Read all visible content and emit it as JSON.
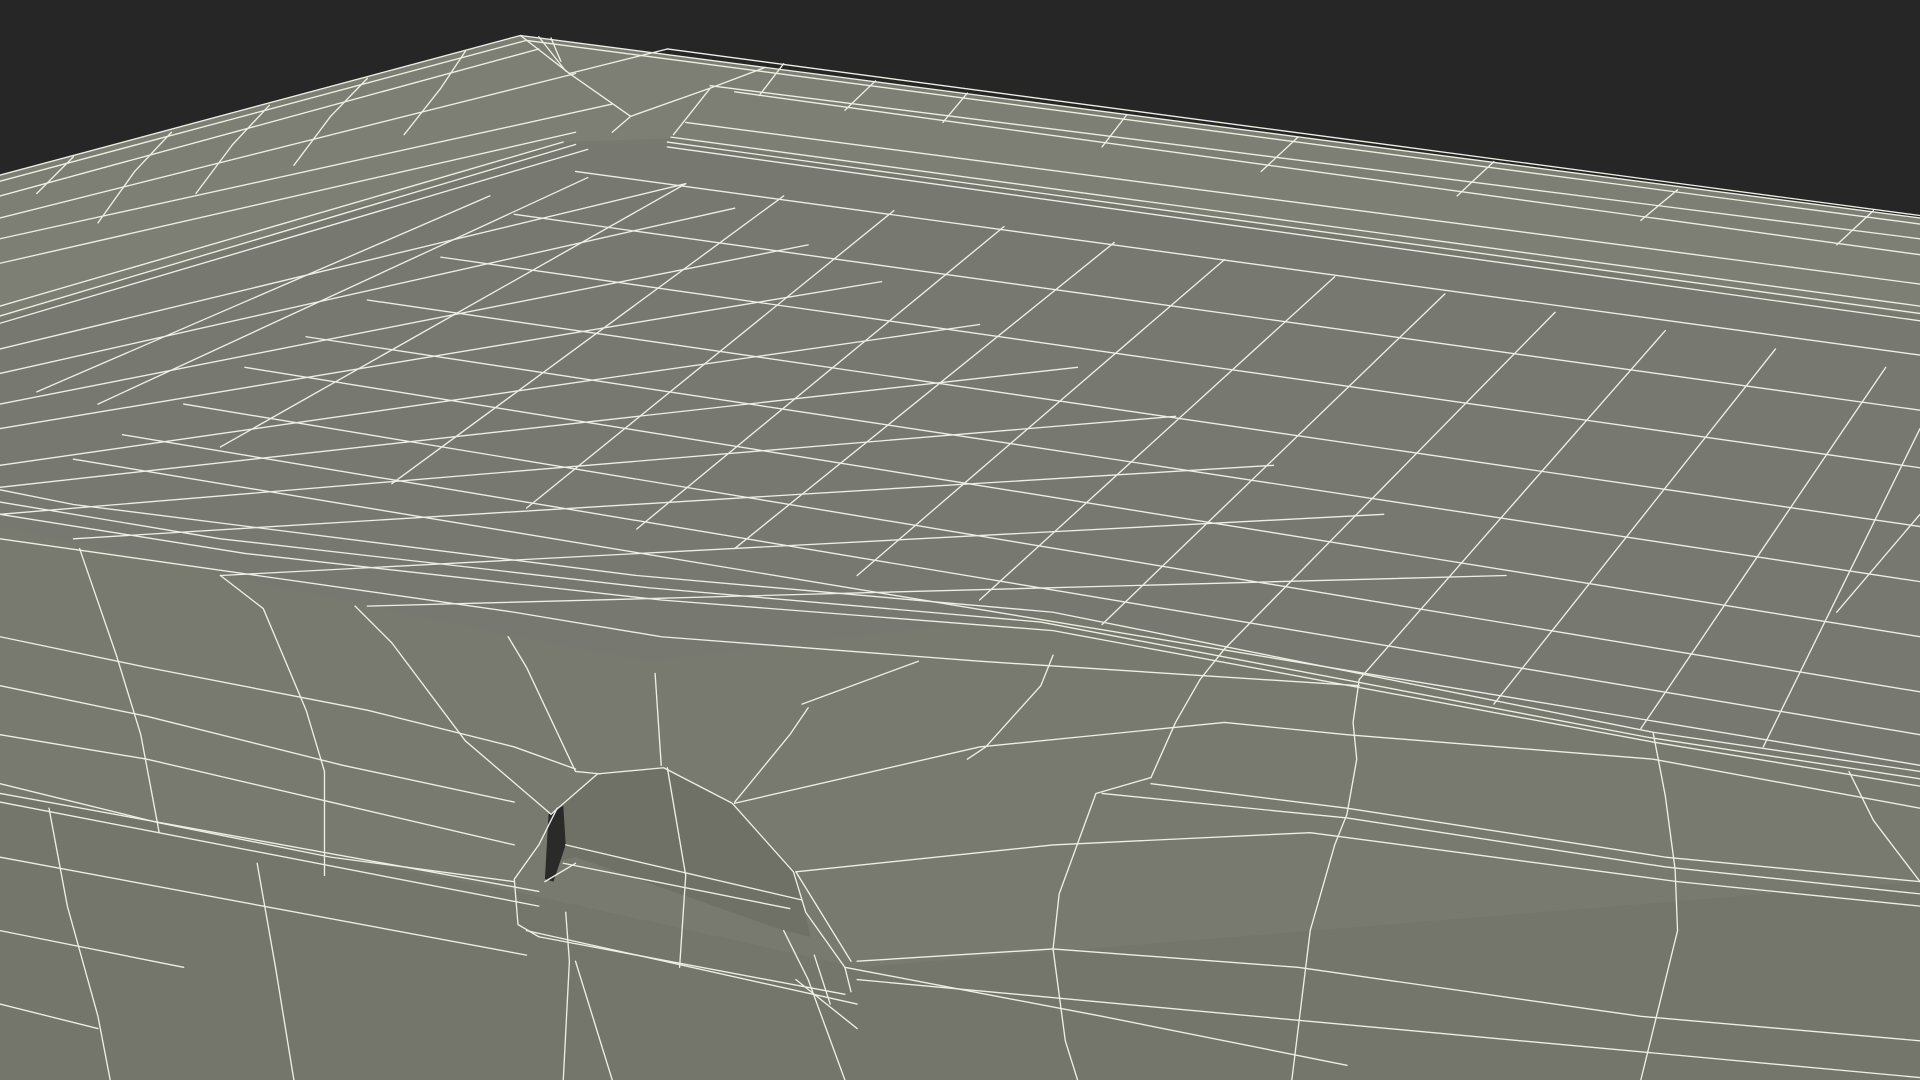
{
  "scene": {
    "subject": "wireframe-mesh-render",
    "colors": {
      "background": "#262626",
      "surface": "#787a6f",
      "surface_light": "#7d7f74",
      "surface_dark": "#6f7166",
      "wire": "#eeeee4",
      "hole": "#2a2b28"
    }
  }
}
